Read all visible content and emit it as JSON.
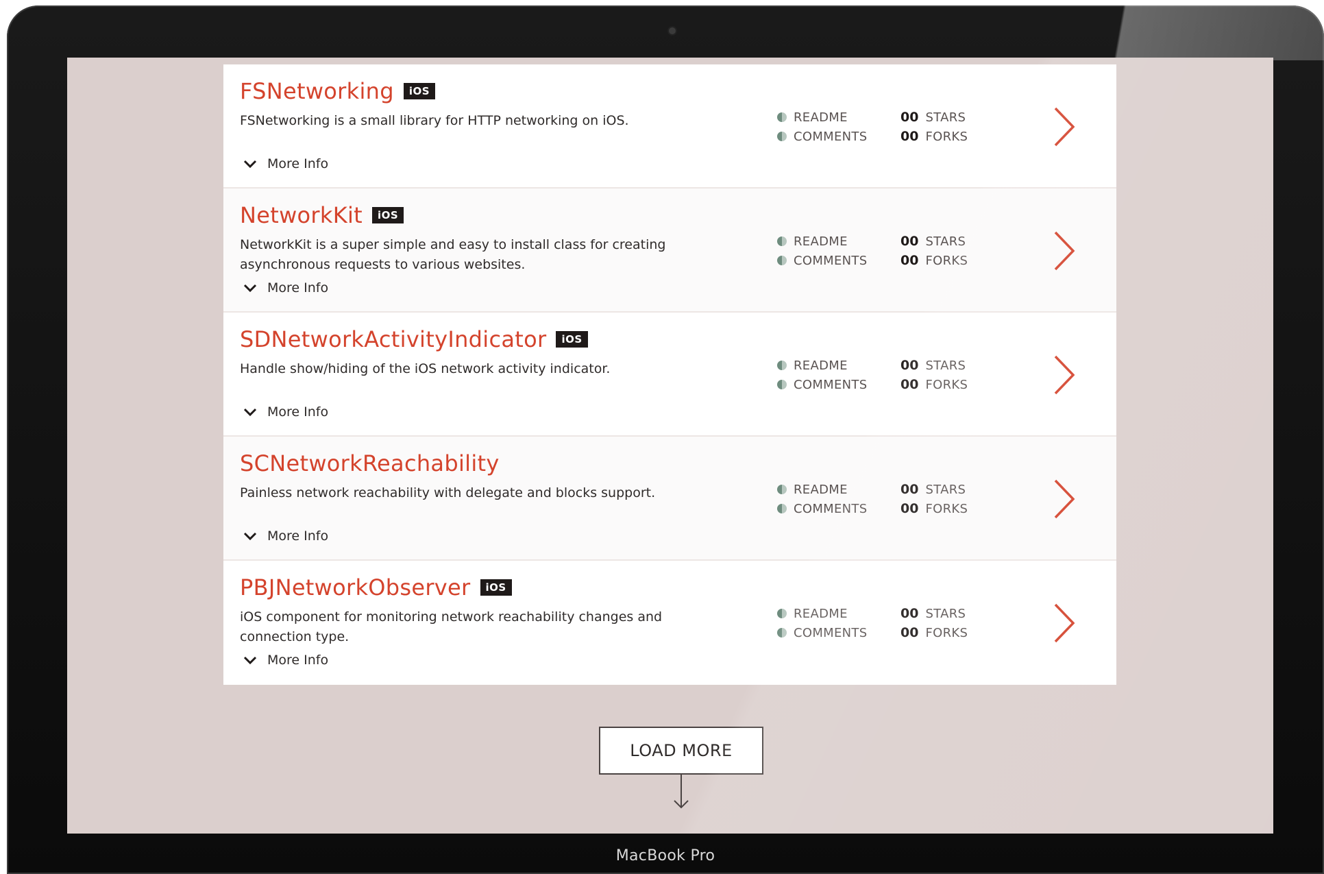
{
  "device": {
    "label": "MacBook Pro"
  },
  "repos": [
    {
      "name": "FSNetworking",
      "badge": "iOS",
      "description": "FSNetworking is a small library for HTTP networking on iOS.",
      "more_info": "More Info",
      "readme": "README",
      "comments": "COMMENTS",
      "stars_count": "00",
      "stars_label": "STARS",
      "forks_count": "00",
      "forks_label": "FORKS"
    },
    {
      "name": "NetworkKit",
      "badge": "iOS",
      "description": "NetworkKit is a super simple and easy to install class for creating asynchronous requests to various websites.",
      "more_info": "More Info",
      "readme": "README",
      "comments": "COMMENTS",
      "stars_count": "00",
      "stars_label": "STARS",
      "forks_count": "00",
      "forks_label": "FORKS"
    },
    {
      "name": "SDNetworkActivityIndicator",
      "badge": "iOS",
      "description": "Handle show/hiding of the iOS network activity indicator.",
      "more_info": "More Info",
      "readme": "README",
      "comments": "COMMENTS",
      "stars_count": "00",
      "stars_label": "STARS",
      "forks_count": "00",
      "forks_label": "FORKS"
    },
    {
      "name": "SCNetworkReachability",
      "badge": "",
      "description": "Painless network reachability with delegate and blocks support.",
      "more_info": "More Info",
      "readme": "README",
      "comments": "COMMENTS",
      "stars_count": "00",
      "stars_label": "STARS",
      "forks_count": "00",
      "forks_label": "FORKS"
    },
    {
      "name": "PBJNetworkObserver",
      "badge": "iOS",
      "description": "iOS component for monitoring network reachability changes and connection type.",
      "more_info": "More Info",
      "readme": "README",
      "comments": "COMMENTS",
      "stars_count": "00",
      "stars_label": "STARS",
      "forks_count": "00",
      "forks_label": "FORKS"
    }
  ],
  "load_more": {
    "label": "LOAD MORE"
  },
  "colors": {
    "accent": "#d4432c",
    "background": "#dbcfcd",
    "badge": "#1f1a19"
  },
  "icons": {
    "more_info": "chevron-down-icon",
    "open_repo": "chevron-right-icon",
    "load_more": "down-arrow-icon",
    "meta": "status-dot-icon"
  }
}
